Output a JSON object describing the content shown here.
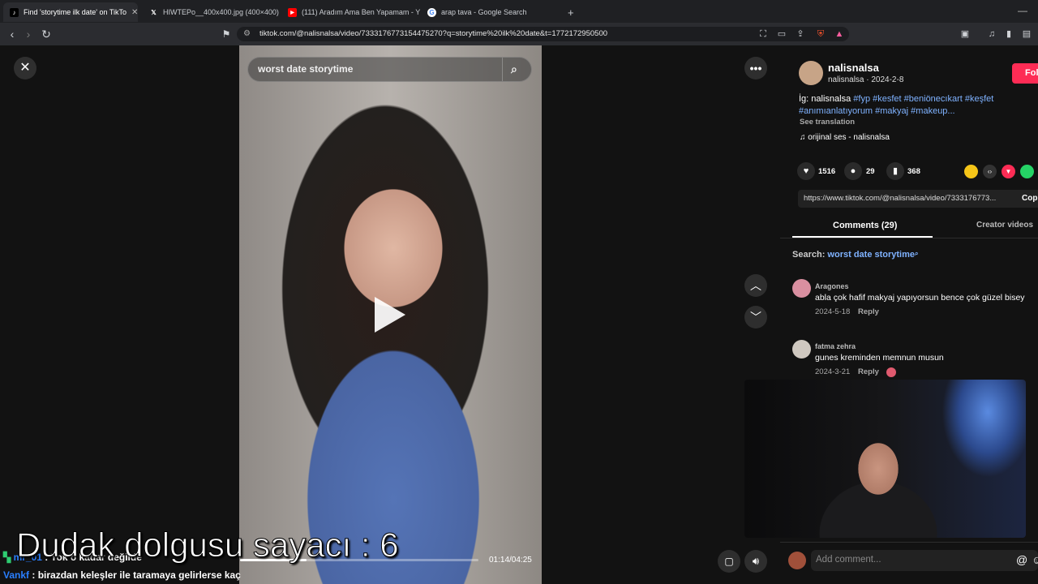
{
  "browser": {
    "tabs": [
      {
        "title": "Find 'storytime ilk date' on TikTo",
        "active": true,
        "favicon": "tiktok-icon"
      },
      {
        "title": "HIWTEPo__400x400.jpg (400×400)",
        "active": false,
        "favicon": "x-icon"
      },
      {
        "title": "(111) Aradım Ama Ben Yapamam - Y",
        "active": false,
        "favicon": "youtube-icon"
      },
      {
        "title": "arap tava - Google Search",
        "active": false,
        "favicon": "google-icon"
      }
    ],
    "new_tab": "+",
    "url": "tiktok.com/@nalisnalsa/video/7333176773154475270?q=storytime%20ilk%20date&t=1772172950500"
  },
  "video": {
    "search_text": "worst date storytime",
    "time": "01:14/04:25",
    "progress": 0.279
  },
  "panel": {
    "author_name": "nalisnalsa",
    "author_sub": "nalisnalsa · 2024-2-8",
    "follow_label": "Fol",
    "caption_prefix": "İg: nalisnalsa",
    "caption_tags_1": "#fyp #kesfet #beniönecıkart #keşfet",
    "caption_tags_2": "#anımıanlatıyorum #makyaj #makeup...",
    "see_translation": "See translation",
    "sound": "orijinal ses - nalisnalsa",
    "likes": "1516",
    "comments_count": "29",
    "saves": "368",
    "link": "https://www.tiktok.com/@nalisnalsa/video/7333176773...",
    "copy_label": "Cop",
    "tab_comments": "Comments (29)",
    "tab_creator": "Creator videos",
    "search_prefix": "Search:",
    "search_term": "worst date storytime",
    "comments": [
      {
        "user": "Aragones",
        "text": "abla çok hafif makyaj yapıyorsun bence çok güzel bisey",
        "date": "2024-5-18",
        "reply": "Reply"
      },
      {
        "user": "fatma zehra",
        "text": "gunes kreminden memnun musun",
        "date": "2024-3-21",
        "reply": "Reply"
      }
    ],
    "add_comment_placeholder": "Add comment..."
  },
  "chat": [
    {
      "user": "mr_01",
      "text": ": Yok o kadar değilde",
      "color": "#2a7fff"
    },
    {
      "user": "Vankf",
      "text": ": birazdan keleşler ile taramaya gelirlerse kaç",
      "color": "#2a7fff"
    }
  ],
  "overlay_text": "Dudak dolgusu  sayacı : 6",
  "colors": {
    "accent": "#fe2c55",
    "tag": "#7fb2ff"
  }
}
